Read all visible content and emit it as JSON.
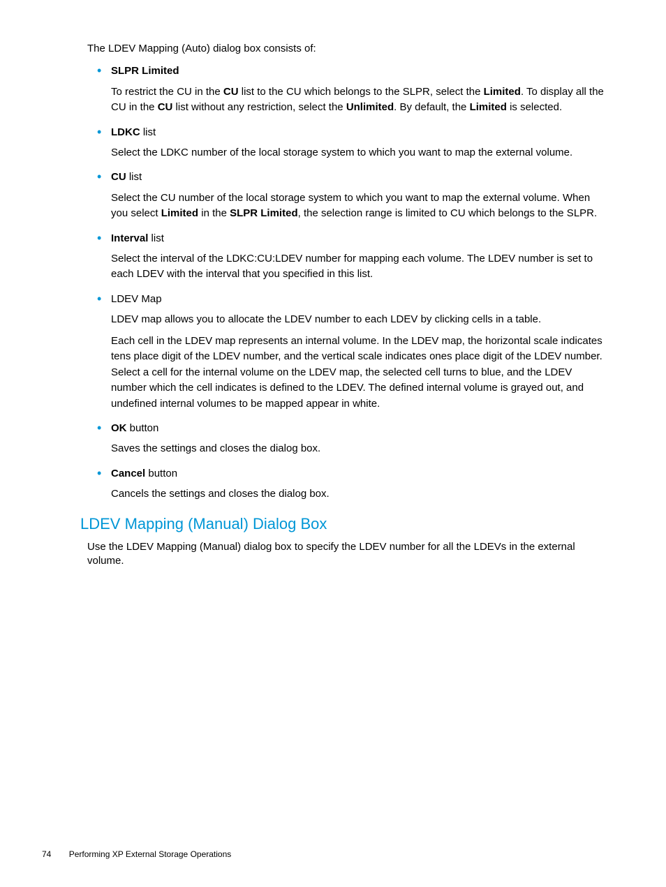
{
  "intro": "The LDEV Mapping (Auto) dialog box consists of:",
  "items": [
    {
      "title_bold": "SLPR Limited",
      "title_suffix": "",
      "segs": [
        {
          "t": "To restrict the CU in the ",
          "b": false
        },
        {
          "t": "CU",
          "b": true
        },
        {
          "t": " list to the CU which belongs to the SLPR, select the ",
          "b": false
        },
        {
          "t": "Limited",
          "b": true
        },
        {
          "t": ". To display all the CU in the ",
          "b": false
        },
        {
          "t": "CU",
          "b": true
        },
        {
          "t": " list without any restriction, select the ",
          "b": false
        },
        {
          "t": "Unlimited",
          "b": true
        },
        {
          "t": ". By default, the ",
          "b": false
        },
        {
          "t": "Limited",
          "b": true
        },
        {
          "t": " is selected.",
          "b": false
        }
      ]
    },
    {
      "title_bold": "LDKC",
      "title_suffix": " list",
      "segs": [
        {
          "t": "Select the LDKC number of the local storage system to which you want to map the external volume.",
          "b": false
        }
      ]
    },
    {
      "title_bold": "CU",
      "title_suffix": " list",
      "segs": [
        {
          "t": "Select the CU number of the local storage system to which you want to map the external volume. When you select ",
          "b": false
        },
        {
          "t": "Limited",
          "b": true
        },
        {
          "t": " in the ",
          "b": false
        },
        {
          "t": "SLPR Limited",
          "b": true
        },
        {
          "t": ", the selection range is limited to CU which belongs to the SLPR.",
          "b": false
        }
      ]
    },
    {
      "title_bold": "Interval",
      "title_suffix": " list",
      "segs": [
        {
          "t": "Select the interval of the LDKC:CU:LDEV number for mapping each volume. The LDEV number is set to each LDEV with the interval that you specified in this list.",
          "b": false
        }
      ]
    },
    {
      "title_bold": "",
      "title_suffix": "LDEV Map",
      "segs": [
        {
          "t": "LDEV map allows you to allocate the LDEV number to each LDEV by clicking cells in a table.",
          "b": false
        }
      ],
      "segs2": [
        {
          "t": "Each cell in the LDEV map represents an internal volume. In the LDEV map, the horizontal scale indicates tens place digit of the LDEV number, and the vertical scale indicates ones place digit of the LDEV number. Select a cell for the internal volume on the LDEV map, the selected cell turns to blue, and the LDEV number which the cell indicates is defined to the LDEV. The defined internal volume is grayed out, and undefined internal volumes to be mapped appear in white.",
          "b": false
        }
      ]
    },
    {
      "title_bold": "OK",
      "title_suffix": " button",
      "segs": [
        {
          "t": "Saves the settings and closes the dialog box.",
          "b": false
        }
      ]
    },
    {
      "title_bold": "Cancel",
      "title_suffix": " button",
      "segs": [
        {
          "t": "Cancels the settings and closes the dialog box.",
          "b": false
        }
      ]
    }
  ],
  "section_heading": "LDEV Mapping (Manual) Dialog Box",
  "section_text": "Use the LDEV Mapping (Manual) dialog box to specify the LDEV number for all the LDEVs in the external volume.",
  "footer": {
    "page": "74",
    "title": "Performing XP External Storage Operations"
  }
}
